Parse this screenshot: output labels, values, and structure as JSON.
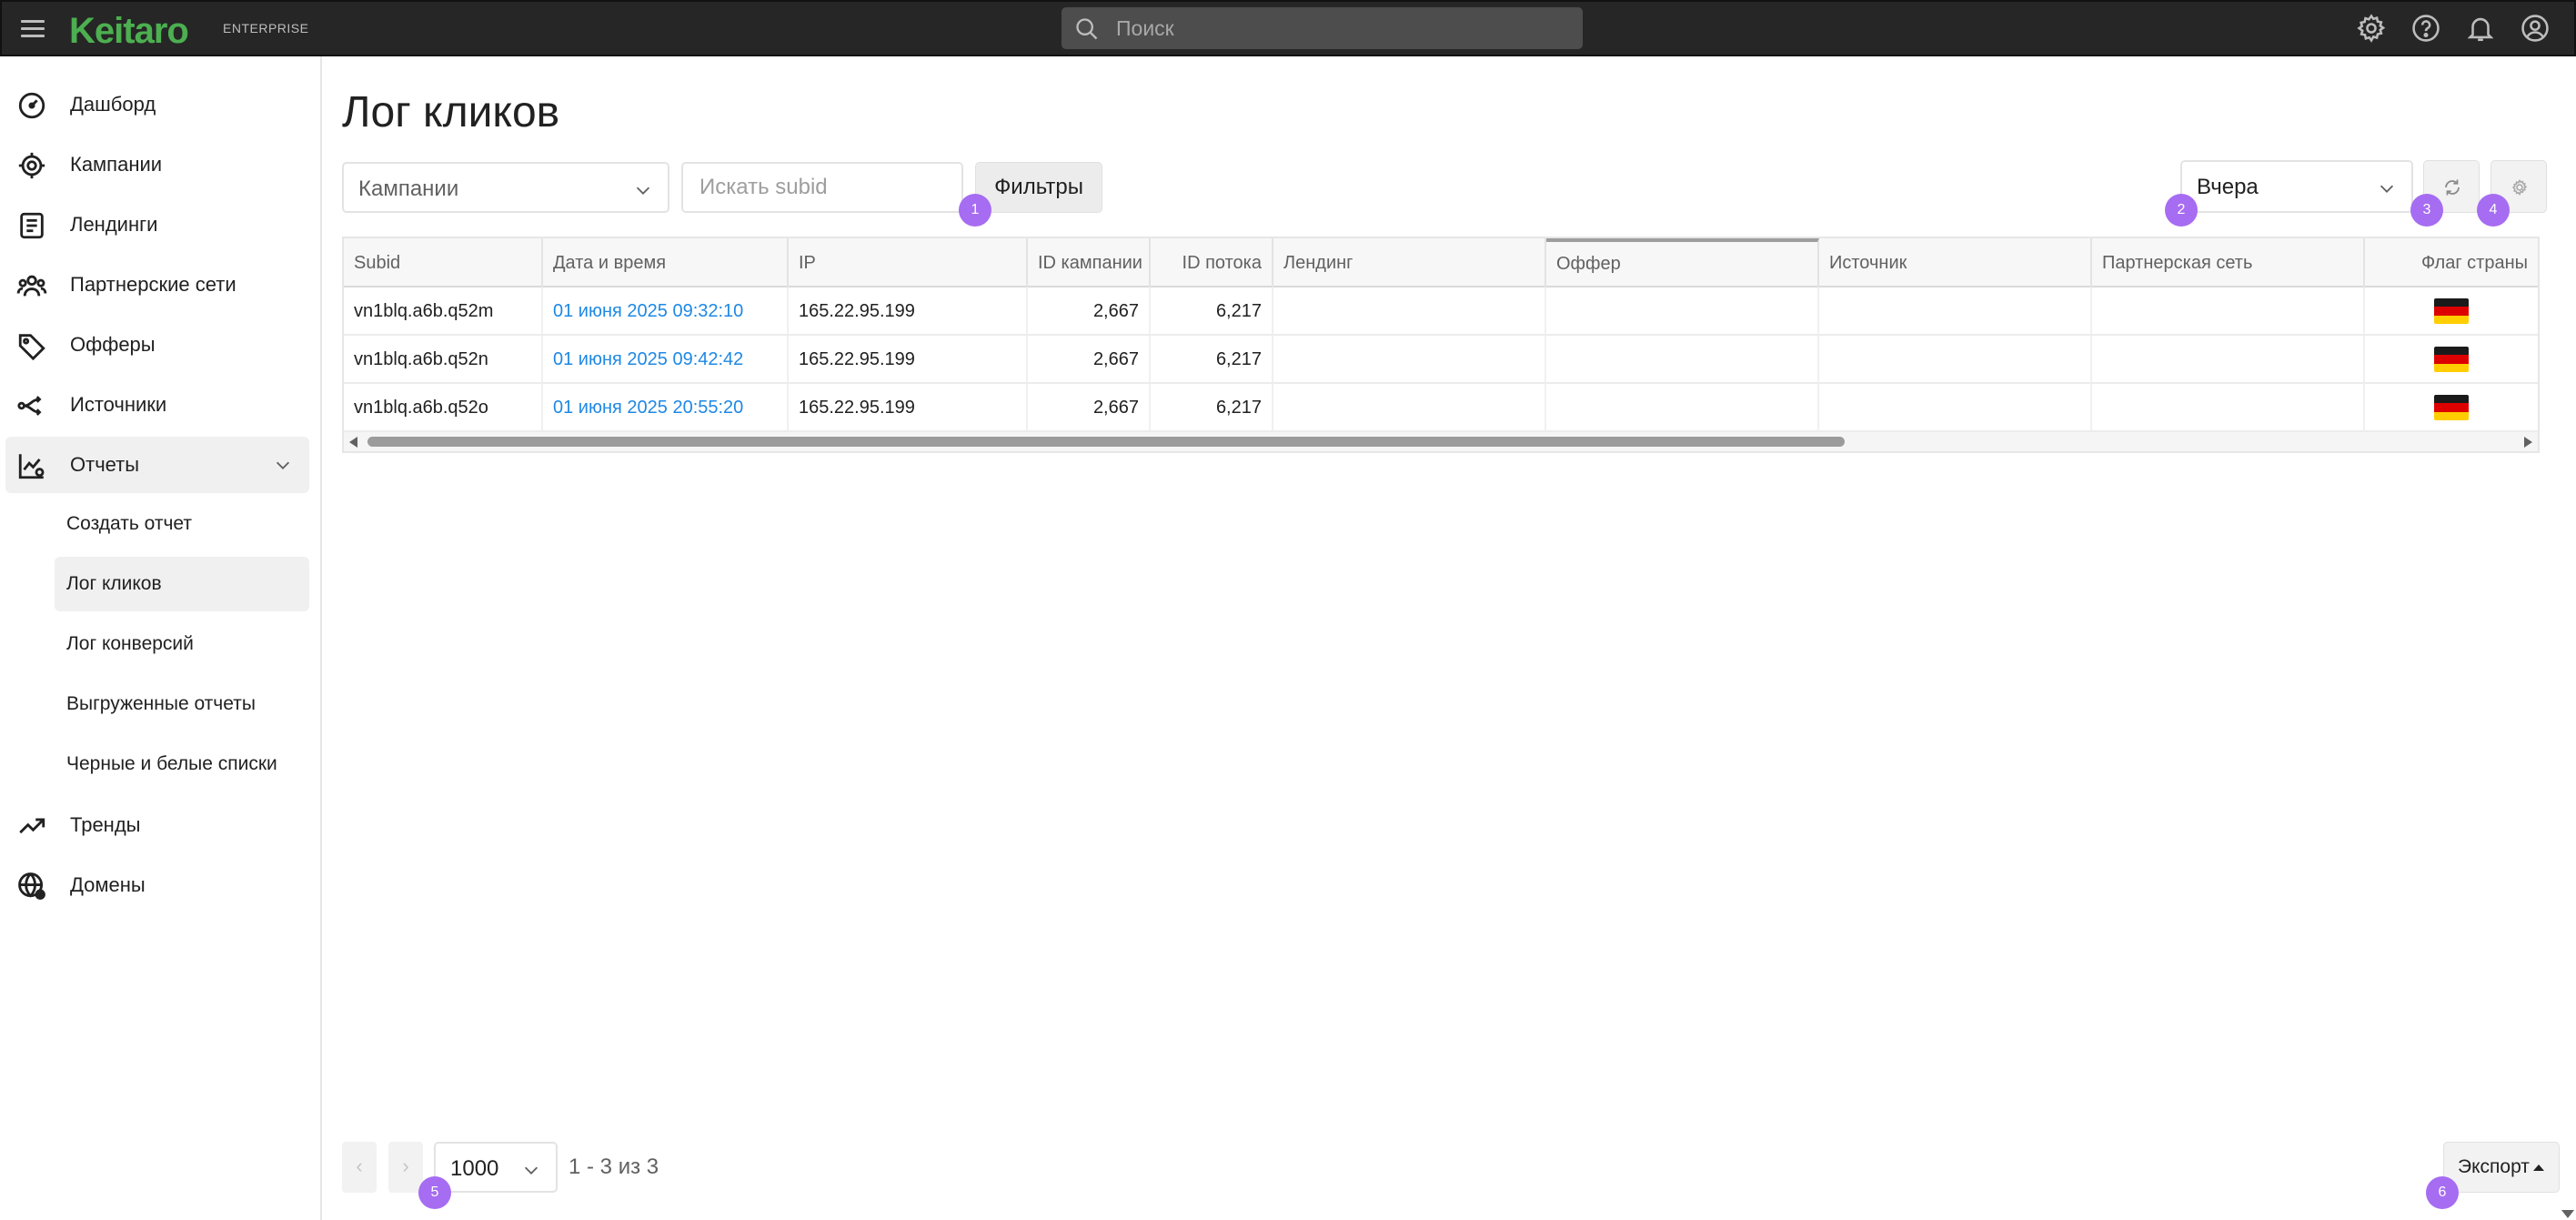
{
  "app": {
    "logo": "Keitaro",
    "edition": "ENTERPRISE"
  },
  "search": {
    "placeholder": "Поиск"
  },
  "sidebar": {
    "items": [
      {
        "label": "Дашборд",
        "icon": "dashboard-icon"
      },
      {
        "label": "Кампании",
        "icon": "target-icon"
      },
      {
        "label": "Лендинги",
        "icon": "landing-page-icon"
      },
      {
        "label": "Партнерские сети",
        "icon": "group-icon"
      },
      {
        "label": "Офферы",
        "icon": "tag-icon"
      },
      {
        "label": "Источники",
        "icon": "source-icon"
      },
      {
        "label": "Отчеты",
        "icon": "reports-icon"
      },
      {
        "label": "Тренды",
        "icon": "trend-icon"
      },
      {
        "label": "Домены",
        "icon": "globe-icon"
      }
    ],
    "reports_sub": [
      "Создать отчет",
      "Лог кликов",
      "Лог конверсий",
      "Выгруженные отчеты",
      "Черные и белые списки"
    ]
  },
  "page": {
    "title": "Лог кликов",
    "campaign_select": "Кампании",
    "subid_placeholder": "Искать subid",
    "filters_label": "Фильтры",
    "period_select": "Вчера"
  },
  "badges": [
    "1",
    "2",
    "3",
    "4",
    "5",
    "6"
  ],
  "table": {
    "columns": [
      "Subid",
      "Дата и время",
      "IP",
      "ID кампании",
      "ID потока",
      "Лендинг",
      "Оффер",
      "Источник",
      "Партнерская сеть",
      "Флаг страны"
    ],
    "rows": [
      {
        "subid": "vn1blq.a6b.q52m",
        "datetime": "01 июня 2025 09:32:10",
        "ip": "165.22.95.199",
        "campaign_id": "2,667",
        "stream_id": "6,217",
        "landing": "",
        "offer": "",
        "source": "",
        "network": "",
        "flag": "DE"
      },
      {
        "subid": "vn1blq.a6b.q52n",
        "datetime": "01 июня 2025 09:42:42",
        "ip": "165.22.95.199",
        "campaign_id": "2,667",
        "stream_id": "6,217",
        "landing": "",
        "offer": "",
        "source": "",
        "network": "",
        "flag": "DE"
      },
      {
        "subid": "vn1blq.a6b.q52o",
        "datetime": "01 июня 2025 20:55:20",
        "ip": "165.22.95.199",
        "campaign_id": "2,667",
        "stream_id": "6,217",
        "landing": "",
        "offer": "",
        "source": "",
        "network": "",
        "flag": "DE"
      }
    ]
  },
  "pagination": {
    "prev": "‹",
    "next": "›",
    "per_page": "1000",
    "range": "1 - 3 из 3"
  },
  "export": {
    "label": "Экспорт"
  },
  "colors": {
    "brand": "#4caf50",
    "topbar": "#262626",
    "link": "#1e88e5",
    "badge": "#a66cf2"
  }
}
